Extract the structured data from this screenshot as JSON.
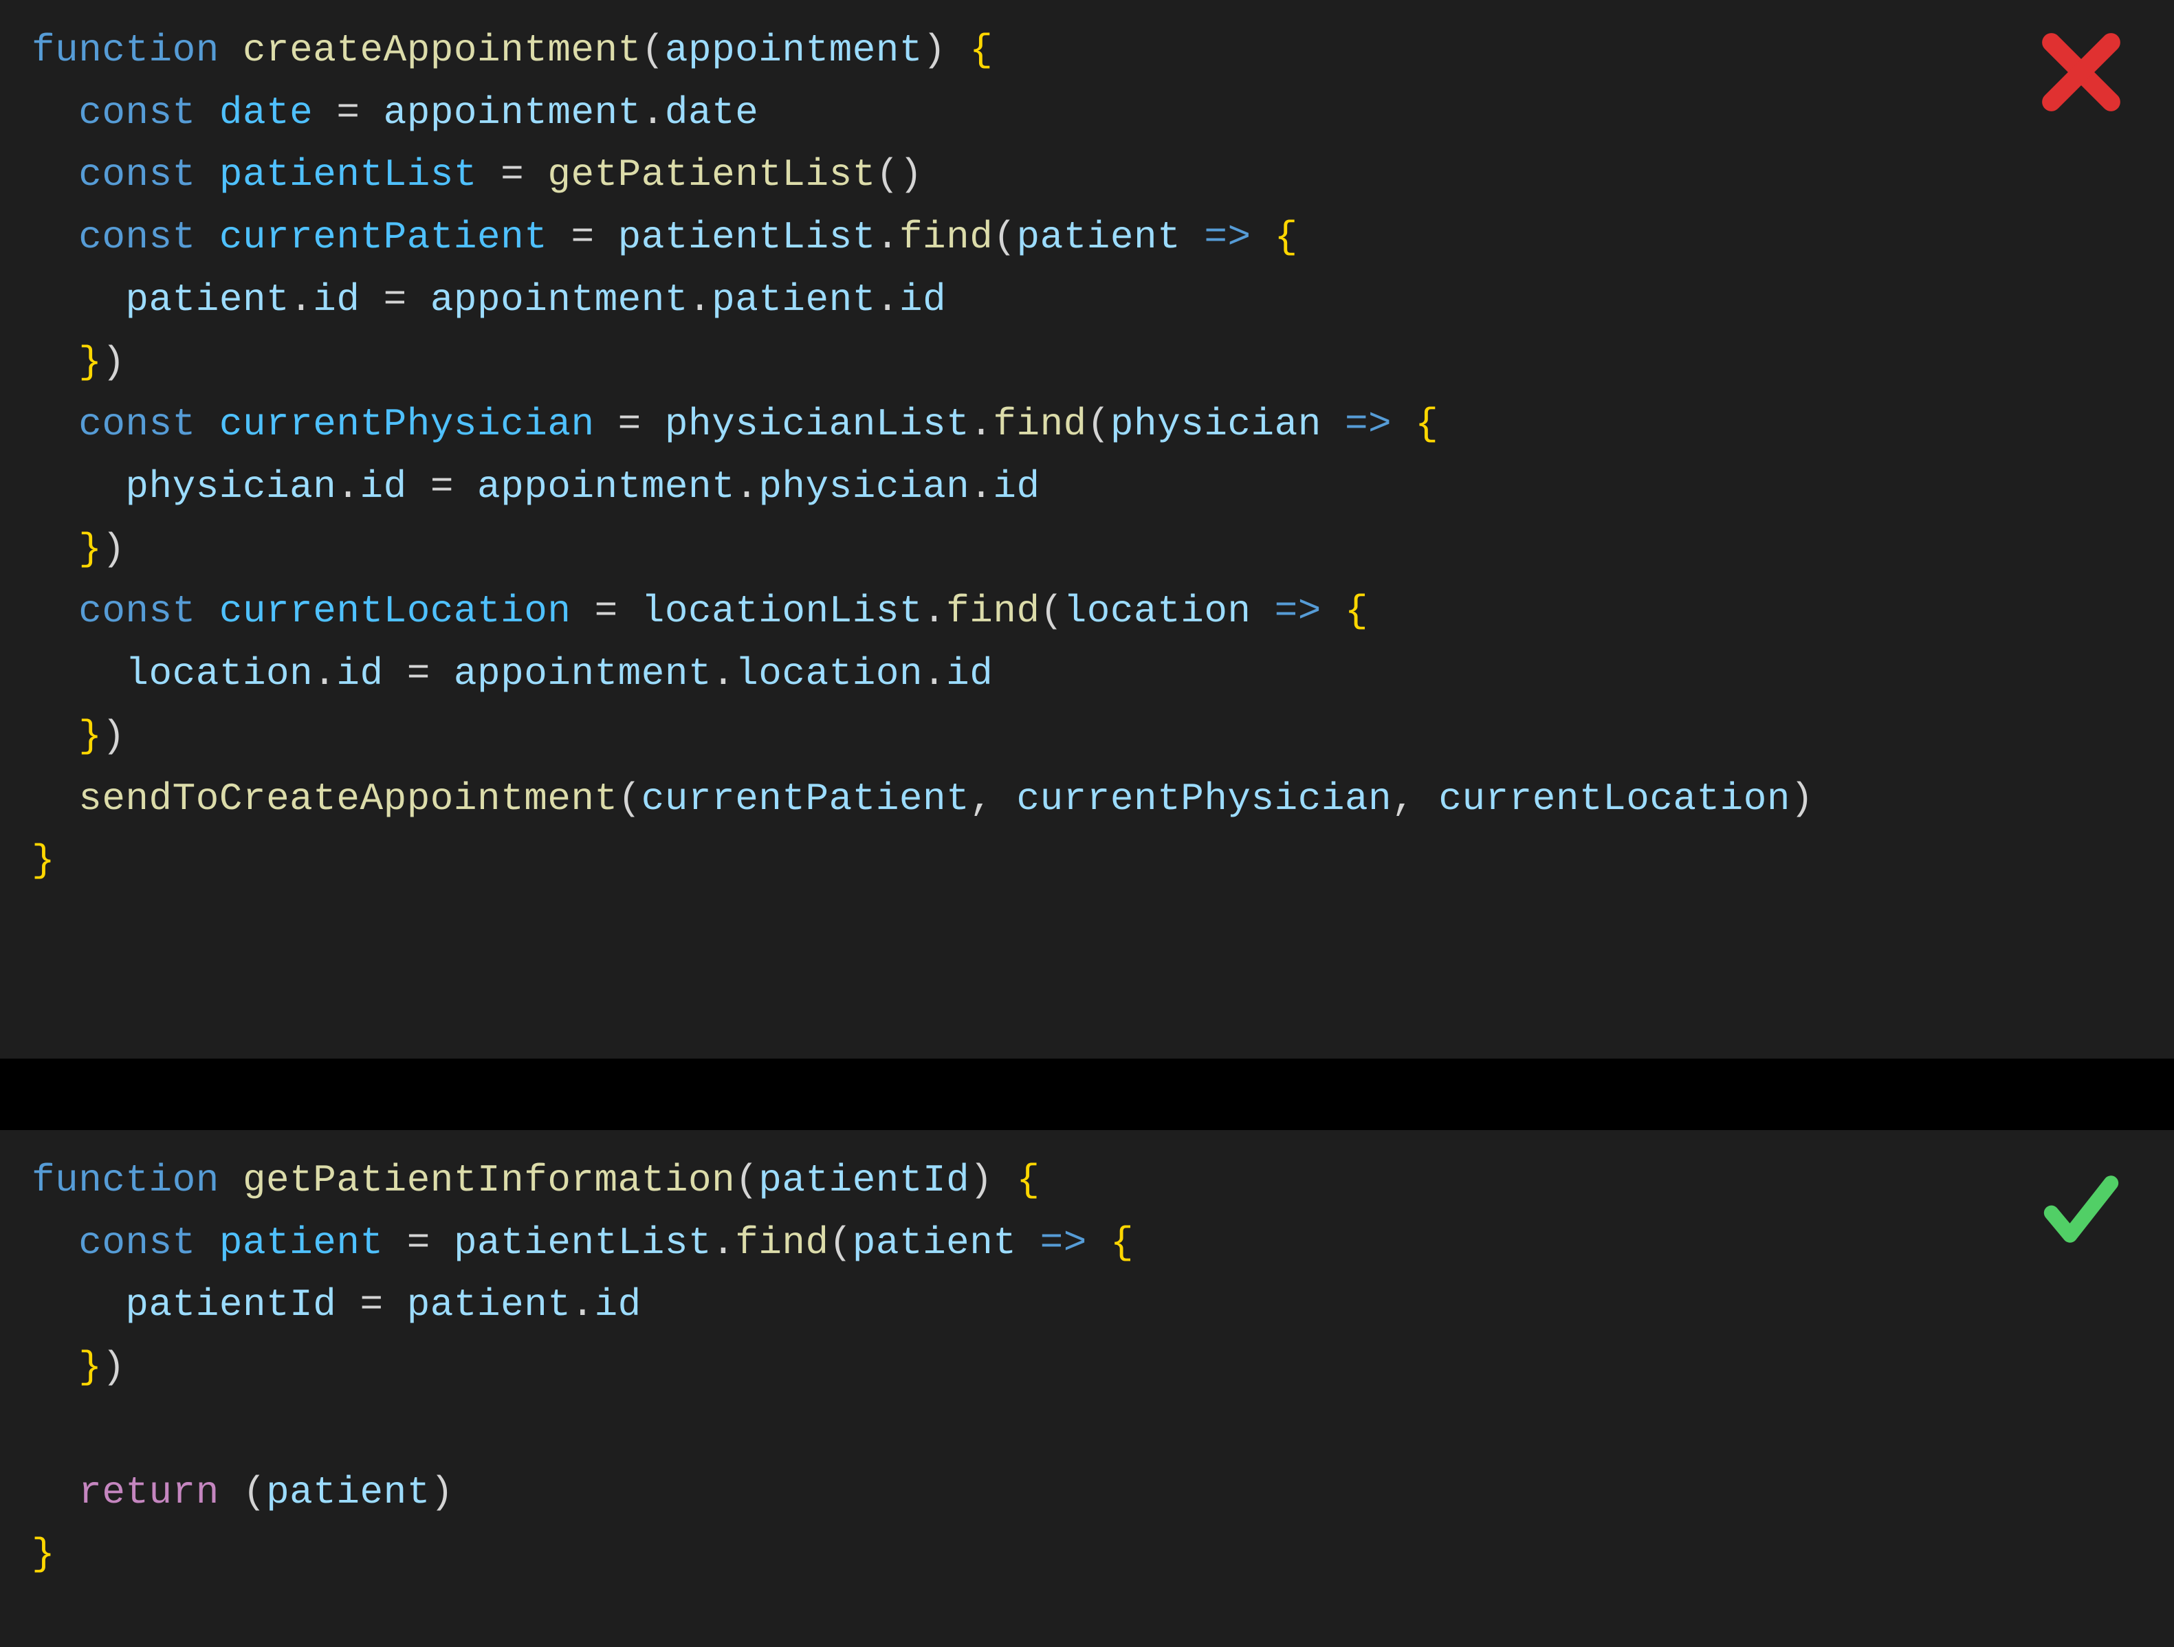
{
  "colors": {
    "editor_bg": "#1e1e1e",
    "gap_bg": "#000000",
    "keyword": "#569cd6",
    "function": "#dcdcaa",
    "variable": "#9cdcfe",
    "constant": "#4fc1ff",
    "brace": "#ffd700",
    "return": "#c586c0",
    "text": "#d4d4d4",
    "cross": "#e03131",
    "check": "#51cf66"
  },
  "marks": {
    "top": "cross-icon",
    "bottom": "check-icon"
  },
  "code_top": {
    "lines": [
      [
        [
          "kw",
          "function"
        ],
        [
          "sp",
          " "
        ],
        [
          "fn",
          "createAppointment"
        ],
        [
          "punc",
          "("
        ],
        [
          "id",
          "appointment"
        ],
        [
          "punc",
          ") "
        ],
        [
          "brace",
          "{"
        ]
      ],
      [
        [
          "sp",
          "  "
        ],
        [
          "kw",
          "const"
        ],
        [
          "sp",
          " "
        ],
        [
          "const",
          "date"
        ],
        [
          "sp",
          " "
        ],
        [
          "op",
          "="
        ],
        [
          "sp",
          " "
        ],
        [
          "id",
          "appointment"
        ],
        [
          "punc",
          "."
        ],
        [
          "prop",
          "date"
        ]
      ],
      [
        [
          "sp",
          "  "
        ],
        [
          "kw",
          "const"
        ],
        [
          "sp",
          " "
        ],
        [
          "const",
          "patientList"
        ],
        [
          "sp",
          " "
        ],
        [
          "op",
          "="
        ],
        [
          "sp",
          " "
        ],
        [
          "fn",
          "getPatientList"
        ],
        [
          "punc",
          "()"
        ]
      ],
      [
        [
          "sp",
          "  "
        ],
        [
          "kw",
          "const"
        ],
        [
          "sp",
          " "
        ],
        [
          "const",
          "currentPatient"
        ],
        [
          "sp",
          " "
        ],
        [
          "op",
          "="
        ],
        [
          "sp",
          " "
        ],
        [
          "id",
          "patientList"
        ],
        [
          "punc",
          "."
        ],
        [
          "fn",
          "find"
        ],
        [
          "punc",
          "("
        ],
        [
          "id",
          "patient"
        ],
        [
          "sp",
          " "
        ],
        [
          "arrow",
          "=>"
        ],
        [
          "sp",
          " "
        ],
        [
          "brace",
          "{"
        ]
      ],
      [
        [
          "sp",
          "    "
        ],
        [
          "id",
          "patient"
        ],
        [
          "punc",
          "."
        ],
        [
          "prop",
          "id"
        ],
        [
          "sp",
          " "
        ],
        [
          "op",
          "="
        ],
        [
          "sp",
          " "
        ],
        [
          "id",
          "appointment"
        ],
        [
          "punc",
          "."
        ],
        [
          "prop",
          "patient"
        ],
        [
          "punc",
          "."
        ],
        [
          "prop",
          "id"
        ]
      ],
      [
        [
          "sp",
          "  "
        ],
        [
          "brace",
          "}"
        ],
        [
          "punc",
          ")"
        ]
      ],
      [
        [
          "sp",
          "  "
        ],
        [
          "kw",
          "const"
        ],
        [
          "sp",
          " "
        ],
        [
          "const",
          "currentPhysician"
        ],
        [
          "sp",
          " "
        ],
        [
          "op",
          "="
        ],
        [
          "sp",
          " "
        ],
        [
          "id",
          "physicianList"
        ],
        [
          "punc",
          "."
        ],
        [
          "fn",
          "find"
        ],
        [
          "punc",
          "("
        ],
        [
          "id",
          "physician"
        ],
        [
          "sp",
          " "
        ],
        [
          "arrow",
          "=>"
        ],
        [
          "sp",
          " "
        ],
        [
          "brace",
          "{"
        ]
      ],
      [
        [
          "sp",
          "    "
        ],
        [
          "id",
          "physician"
        ],
        [
          "punc",
          "."
        ],
        [
          "prop",
          "id"
        ],
        [
          "sp",
          " "
        ],
        [
          "op",
          "="
        ],
        [
          "sp",
          " "
        ],
        [
          "id",
          "appointment"
        ],
        [
          "punc",
          "."
        ],
        [
          "prop",
          "physician"
        ],
        [
          "punc",
          "."
        ],
        [
          "prop",
          "id"
        ]
      ],
      [
        [
          "sp",
          "  "
        ],
        [
          "brace",
          "}"
        ],
        [
          "punc",
          ")"
        ]
      ],
      [
        [
          "sp",
          "  "
        ],
        [
          "kw",
          "const"
        ],
        [
          "sp",
          " "
        ],
        [
          "const",
          "currentLocation"
        ],
        [
          "sp",
          " "
        ],
        [
          "op",
          "="
        ],
        [
          "sp",
          " "
        ],
        [
          "id",
          "locationList"
        ],
        [
          "punc",
          "."
        ],
        [
          "fn",
          "find"
        ],
        [
          "punc",
          "("
        ],
        [
          "id",
          "location"
        ],
        [
          "sp",
          " "
        ],
        [
          "arrow",
          "=>"
        ],
        [
          "sp",
          " "
        ],
        [
          "brace",
          "{"
        ]
      ],
      [
        [
          "sp",
          "    "
        ],
        [
          "id",
          "location"
        ],
        [
          "punc",
          "."
        ],
        [
          "prop",
          "id"
        ],
        [
          "sp",
          " "
        ],
        [
          "op",
          "="
        ],
        [
          "sp",
          " "
        ],
        [
          "id",
          "appointment"
        ],
        [
          "punc",
          "."
        ],
        [
          "prop",
          "location"
        ],
        [
          "punc",
          "."
        ],
        [
          "prop",
          "id"
        ]
      ],
      [
        [
          "sp",
          "  "
        ],
        [
          "brace",
          "}"
        ],
        [
          "punc",
          ")"
        ]
      ],
      [
        [
          "sp",
          "  "
        ],
        [
          "fn",
          "sendToCreateAppointment"
        ],
        [
          "punc",
          "("
        ],
        [
          "id",
          "currentPatient"
        ],
        [
          "punc",
          ", "
        ],
        [
          "id",
          "currentPhysician"
        ],
        [
          "punc",
          ", "
        ],
        [
          "id",
          "currentLocation"
        ],
        [
          "punc",
          ")"
        ]
      ],
      [
        [
          "brace",
          "}"
        ]
      ]
    ]
  },
  "code_bottom": {
    "lines": [
      [
        [
          "kw",
          "function"
        ],
        [
          "sp",
          " "
        ],
        [
          "fn",
          "getPatientInformation"
        ],
        [
          "punc",
          "("
        ],
        [
          "id",
          "patientId"
        ],
        [
          "punc",
          ") "
        ],
        [
          "brace",
          "{"
        ]
      ],
      [
        [
          "sp",
          "  "
        ],
        [
          "kw",
          "const"
        ],
        [
          "sp",
          " "
        ],
        [
          "const",
          "patient"
        ],
        [
          "sp",
          " "
        ],
        [
          "op",
          "="
        ],
        [
          "sp",
          " "
        ],
        [
          "id",
          "patientList"
        ],
        [
          "punc",
          "."
        ],
        [
          "fn",
          "find"
        ],
        [
          "punc",
          "("
        ],
        [
          "id",
          "patient"
        ],
        [
          "sp",
          " "
        ],
        [
          "arrow",
          "=>"
        ],
        [
          "sp",
          " "
        ],
        [
          "brace",
          "{"
        ]
      ],
      [
        [
          "sp",
          "    "
        ],
        [
          "id",
          "patientId"
        ],
        [
          "sp",
          " "
        ],
        [
          "op",
          "="
        ],
        [
          "sp",
          " "
        ],
        [
          "id",
          "patient"
        ],
        [
          "punc",
          "."
        ],
        [
          "prop",
          "id"
        ]
      ],
      [
        [
          "sp",
          "  "
        ],
        [
          "brace",
          "}"
        ],
        [
          "punc",
          ")"
        ]
      ],
      [
        [
          "sp",
          ""
        ]
      ],
      [
        [
          "sp",
          "  "
        ],
        [
          "ret",
          "return"
        ],
        [
          "sp",
          " "
        ],
        [
          "punc",
          "("
        ],
        [
          "id",
          "patient"
        ],
        [
          "punc",
          ")"
        ]
      ],
      [
        [
          "brace",
          "}"
        ]
      ]
    ]
  }
}
